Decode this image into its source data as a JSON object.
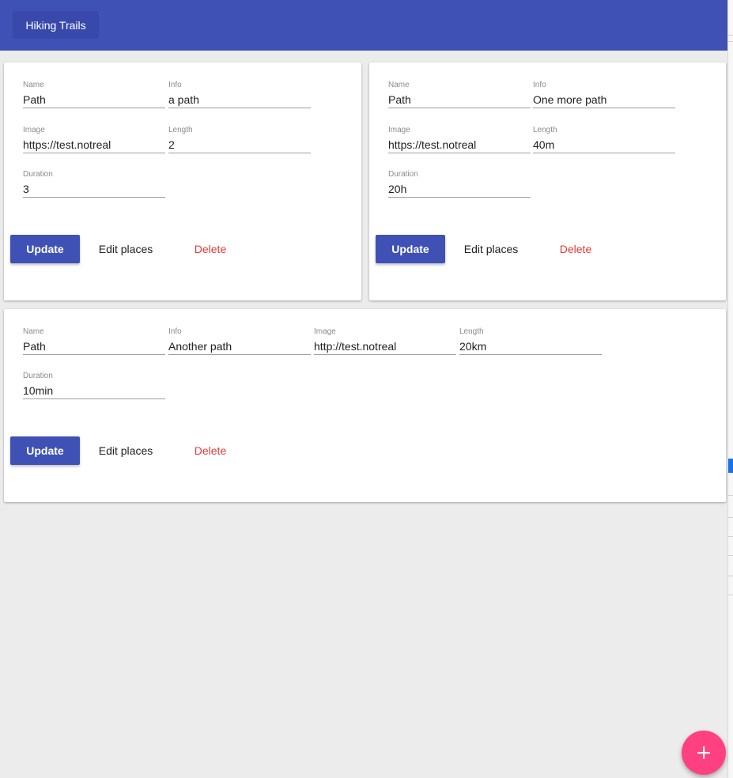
{
  "app": {
    "title": "Hiking Trails"
  },
  "labels": {
    "name": "Name",
    "info": "Info",
    "image": "Image",
    "length": "Length",
    "duration": "Duration"
  },
  "actions": {
    "update": "Update",
    "edit_places": "Edit places",
    "delete": "Delete"
  },
  "trails": [
    {
      "name": "Path",
      "info": "a path",
      "image": "https://test.notreal",
      "length": "2",
      "duration": "3"
    },
    {
      "name": "Path",
      "info": "One more path",
      "image": "https://test.notreal",
      "length": "40m",
      "duration": "20h"
    },
    {
      "name": "Path",
      "info": "Another path",
      "image": "http://test.notreal",
      "length": "20km",
      "duration": "10min"
    }
  ],
  "fab": {
    "icon": "plus-icon"
  },
  "colors": {
    "primary": "#3f51b5",
    "accent": "#ff4081",
    "danger": "#e53935",
    "background": "#ececec"
  }
}
